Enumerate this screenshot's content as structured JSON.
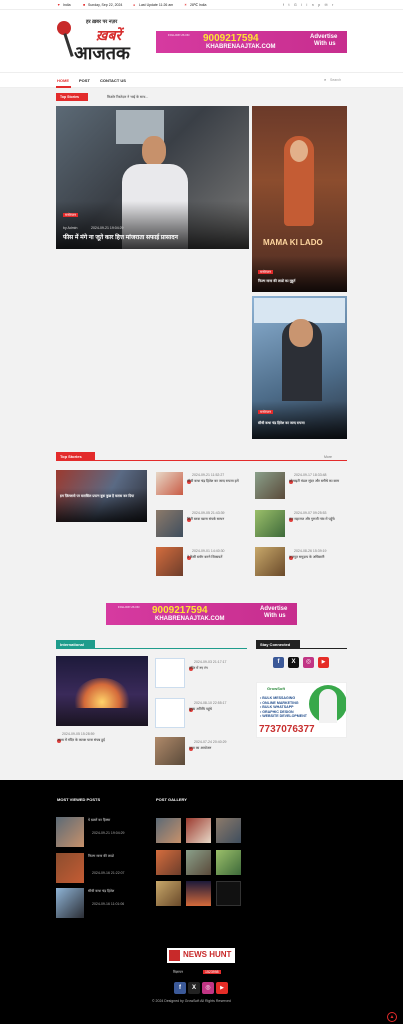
{
  "topbar": {
    "location": "India",
    "date": "Sunday, Sep 22, 2024",
    "last_update": "Last Update 11:26 am",
    "temp": "28℃ India"
  },
  "logo": {
    "line1": "हर ख़बर पर नज़र",
    "line2": "ख़बरें",
    "line3": "आजतक"
  },
  "ad": {
    "phone": "9009217594",
    "site": "KHABRENAAJTAK.COM",
    "right1": "Advertise",
    "right2": "With us",
    "follow": "FOLLOW US ON"
  },
  "nav": {
    "items": [
      "HOME",
      "POST",
      "CONTACT US"
    ],
    "search_placeholder": "Search"
  },
  "ticker": {
    "label": "Top Stories",
    "text": "किशोर रिश्तेदार ने भाई के साथ..."
  },
  "hero": {
    "cat": "मनोरंजन",
    "author": "by Admin",
    "date": "2024-09-21 19:04:29",
    "title": "फीस में मंगे ना जूते कार हित्त मांजराता सफाई प्रासादन"
  },
  "side": [
    {
      "title": "MAMA KI LADO",
      "cat": "मनोरंजन",
      "caption": "फिल्म मामा की लाडो का मुहूर्त"
    },
    {
      "title": "सीधी कथा चंद्र हितेश का जल्द रायजा",
      "cat": "मनोरंजन",
      "caption": ""
    }
  ],
  "tops": {
    "label": "Top Stories",
    "more": "More"
  },
  "tops_big": {
    "title": "इम ज़िल्लासे पर बतासिल प्रयत्न बुक कुछ है बतास कर दिया",
    "date": ""
  },
  "tops_col1": [
    {
      "date": "2024-09-21 11:52:27",
      "title": "सीधी कथा चंद्र हितेश का जल्द रायजा हमें"
    },
    {
      "date": "2024-09-05 21:43:39",
      "title": "सिटी बरवा खाना संपर्क साधन"
    },
    {
      "date": "2024-09-01 14:40:30",
      "title": "ये कैसी ब्लॉग करने शिकायतें"
    }
  ],
  "tops_col2": [
    {
      "date": "2024-09-17 18:33:48",
      "title": "सोसाइटी मंडल सुंदर और बगीचे का काम"
    },
    {
      "date": "2024-09-07 09:25:53",
      "title": "संत महाराज और गुरुजी गांव में पहुँचे"
    },
    {
      "date": "2024-08-26 15:39:19",
      "title": "राजपूत समुदाय के अधिकारी"
    }
  ],
  "intl": {
    "label": "International",
    "big_date": "2024-09-05 15:28:59",
    "big_title": "अवध में मंदिर के कलश यात्रा संपन्न हुई",
    "list": [
      {
        "date": "2024-09-03 21:17:17",
        "title": "मंदिर में नए रंग"
      },
      {
        "date": "2024-08-10 22:55:17",
        "title": "मुख्य अतिथि पहुंचे"
      },
      {
        "date": "2024-07-24 20:40:29",
        "title": "यात्रा का आयोजन"
      }
    ]
  },
  "stay": {
    "label": "Stay Connected",
    "services": [
      "• BULK MESSAGING",
      "• ONLINE MARKETING",
      "• BULK WHATSAPP",
      "• GRAPHIC DESIGN",
      "• WEBSITE DEVELOPMENT"
    ],
    "phone": "7737076377",
    "brand": "GrowSoft"
  },
  "footer": {
    "viewed": "MOST VIEWED POSTS",
    "gallery": "POST GALLERY",
    "viewed_items": [
      {
        "title": "ये ख़बरें का हिस्सा",
        "date": "2024-09-21 19:04:29"
      },
      {
        "title": "फिल्म मामा की लाडो",
        "date": "2024-09-16 21:22:07"
      },
      {
        "title": "सीधी कथा चंद्र हितेश",
        "date": "2024-09-16 11:01:06"
      }
    ],
    "logo2": "NEWS HUNT",
    "tagline": "विज्ञापन",
    "copy": "© 2024 Designed by GrowSoft All Rights Reserved",
    "views": "1523998"
  }
}
